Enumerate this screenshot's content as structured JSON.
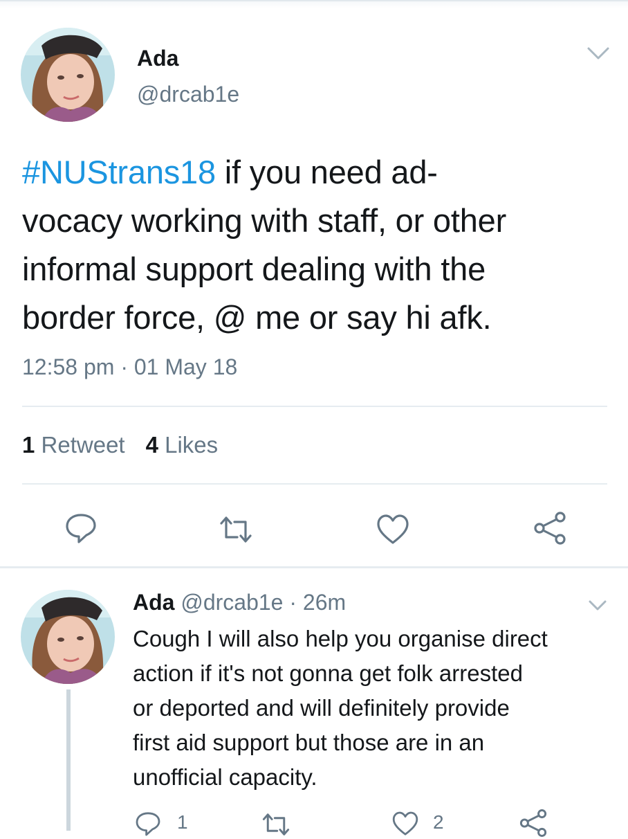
{
  "tweet": {
    "name": "Ada",
    "handle": "@drcab1e",
    "hashtag": "#NUStrans18",
    "text_line1": " if you need ad-",
    "text_line2": "vocacy working with staff, or other",
    "text_line3": "informal support dealing with the",
    "text_line4": "border force, @ me or say hi afk.",
    "time": "12:58 pm",
    "sep": " · ",
    "date": "01 May 18",
    "retweet_count": "1",
    "retweet_label": "Retweet",
    "like_count": "4",
    "like_label": "Likes"
  },
  "reply": {
    "name": "Ada",
    "handle": "@drcab1e",
    "sep": " · ",
    "time": "26m",
    "lines": [
      "Cough I will also help you organise direct",
      "action if it's not gonna get folk arrested",
      "or deported and will definitely provide",
      "first aid support but those are in an",
      "unofficial capacity."
    ],
    "reply_count": "1",
    "like_count": "2"
  },
  "icons": [
    "chevron-down-icon",
    "reply-icon",
    "retweet-icon",
    "like-icon",
    "share-icon"
  ],
  "colors": {
    "accent": "#1b95e0",
    "text": "#14171a",
    "muted": "#657786",
    "divider": "#e6ecf0",
    "icon": "#657786"
  }
}
